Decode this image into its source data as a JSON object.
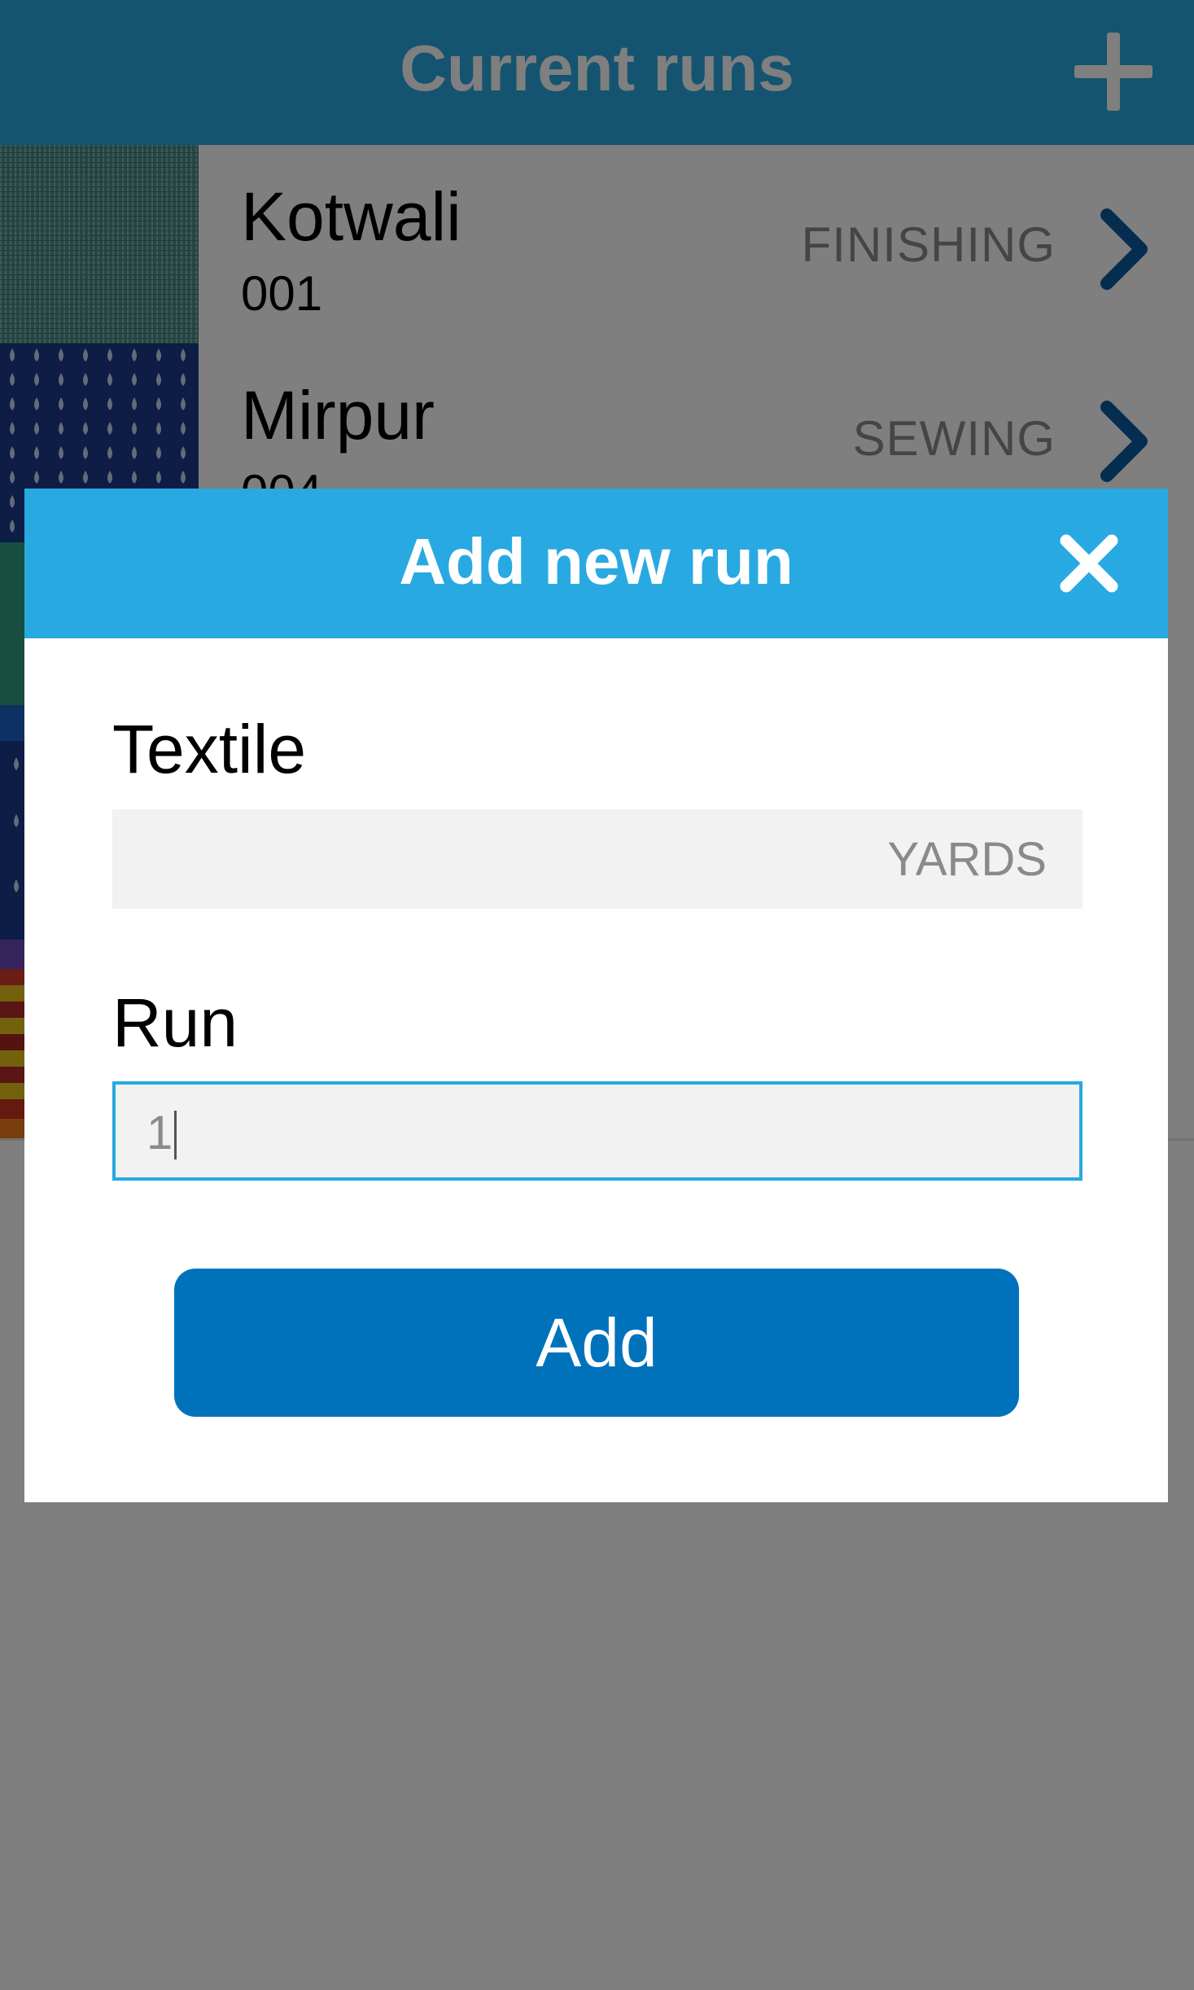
{
  "header": {
    "title": "Current runs",
    "add_icon": "plus-icon"
  },
  "runs": [
    {
      "name": "Kotwali",
      "number": "001",
      "status": "FINISHING",
      "icon": "chevron-right-icon"
    },
    {
      "name": "Mirpur",
      "number": "004",
      "status": "SEWING",
      "icon": "chevron-right-icon"
    }
  ],
  "modal": {
    "title": "Add new run",
    "close_icon": "close-icon",
    "textile_label": "Textile",
    "textile_unit": "YARDS",
    "run_label": "Run",
    "run_value": "1",
    "add_label": "Add"
  },
  "colors": {
    "accent": "#29a9e1",
    "primary_button": "#0072bc",
    "chevron": "#0a5aa0"
  }
}
